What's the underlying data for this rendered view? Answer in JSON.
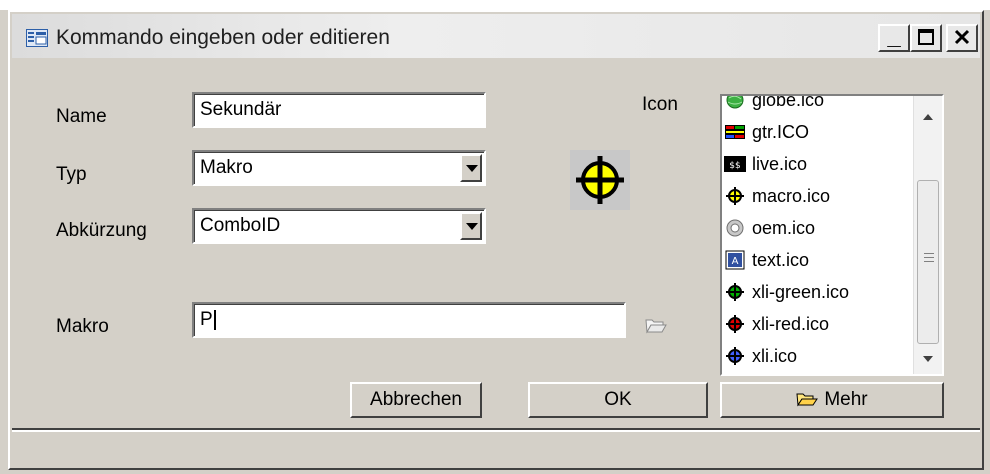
{
  "window": {
    "title": "Kommando eingeben oder editieren",
    "caption_buttons": {
      "minimize": "_",
      "maximize": "☐",
      "close": "×"
    }
  },
  "form": {
    "name_label": "Name",
    "name_value": "Sekundär",
    "typ_label": "Typ",
    "typ_value": "Makro",
    "abk_label": "Abkürzung",
    "abk_value": "ComboID",
    "makro_label": "Makro",
    "makro_value": "P",
    "icon_label": "Icon"
  },
  "icon_list": {
    "items": [
      {
        "label": "globe.ico",
        "icon": "globe-icon"
      },
      {
        "label": "gtr.ICO",
        "icon": "gtr-icon"
      },
      {
        "label": "live.ico",
        "icon": "live-icon"
      },
      {
        "label": "macro.ico",
        "icon": "macro-crosshair-icon"
      },
      {
        "label": "oem.ico",
        "icon": "oem-icon"
      },
      {
        "label": "text.ico",
        "icon": "text-icon"
      },
      {
        "label": "xli-green.ico",
        "icon": "green-crosshair-icon"
      },
      {
        "label": "xli-red.ico",
        "icon": "red-crosshair-icon"
      },
      {
        "label": "xli.ico",
        "icon": "blue-crosshair-icon"
      }
    ]
  },
  "buttons": {
    "cancel": "Abbrechen",
    "ok": "OK",
    "more": "Mehr"
  },
  "colors": {
    "face": "#d4d0c8",
    "crosshair_yellow": "#ffff00",
    "green": "#00b000",
    "red": "#e00000",
    "blue": "#4060ff"
  }
}
